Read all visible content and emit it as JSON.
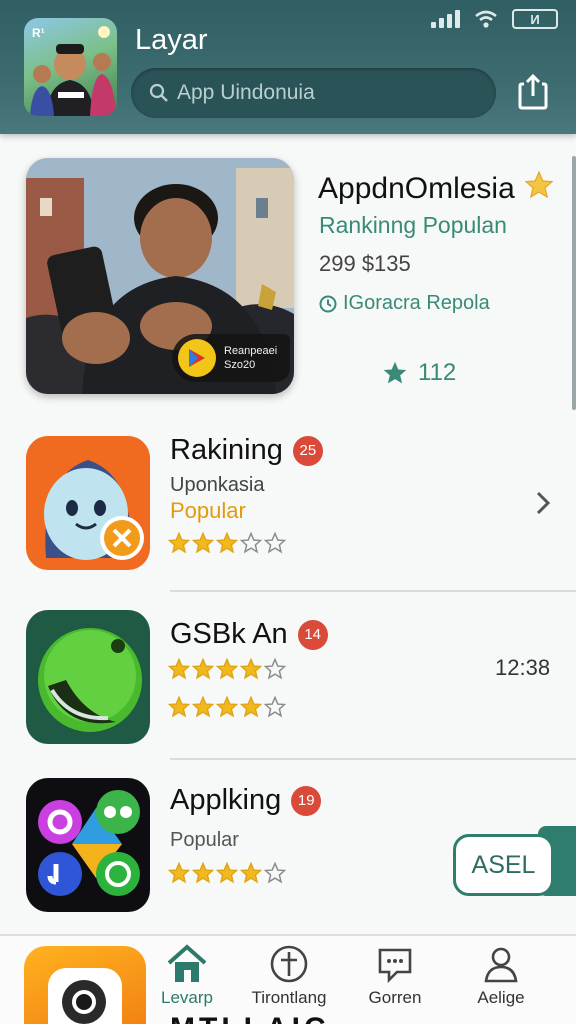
{
  "status_bar": {
    "battery_text": "И"
  },
  "header": {
    "title": "Layar",
    "avatar_text": "R¹",
    "search_placeholder": "App Uindonuia"
  },
  "featured": {
    "title": "AppdnOmlesia",
    "subtitle": "Rankinng Populan",
    "price": "299 $135",
    "meta": "IGoracra Repola",
    "rating": "112",
    "badge_line1": "Reanpeaei",
    "badge_line2": "Szo20"
  },
  "apps": [
    {
      "name": "Rakining",
      "badge": "25",
      "subtitle": "Uponkasia",
      "tag": "Popular",
      "stars": 3
    },
    {
      "name": "GSBk An",
      "badge": "14",
      "stars_row1": 4,
      "stars_row2": 4,
      "time": "12:38"
    },
    {
      "name": "Applking",
      "badge": "19",
      "subtitle": "Popular",
      "stars": 4,
      "action_label": "ASEL"
    }
  ],
  "bottom_nav": [
    {
      "label": "Levarp",
      "icon": "home-icon",
      "active": true
    },
    {
      "label": "Tirontlang",
      "icon": "compass-icon",
      "active": false
    },
    {
      "label": "Gorren",
      "icon": "message-icon",
      "active": false
    },
    {
      "label": "Aelige",
      "icon": "profile-icon",
      "active": false
    }
  ],
  "bottom_partial_text": "MTLLAIC",
  "colors": {
    "header": "#3c6c70",
    "accent_green": "#3a8a78",
    "star": "#f1b81f",
    "badge_red": "#d94a38",
    "popular": "#e49a10"
  }
}
